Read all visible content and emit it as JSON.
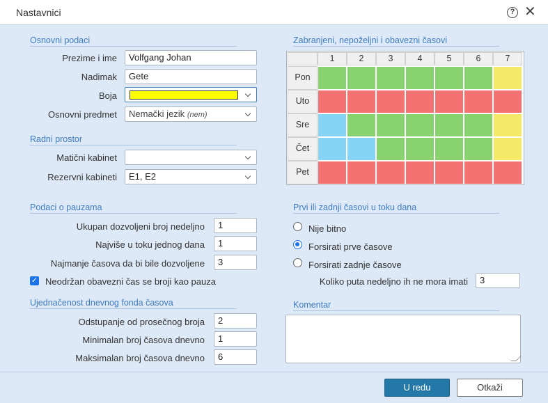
{
  "dialog": {
    "title": "Nastavnici",
    "help_icon": "?",
    "close_icon": "✕"
  },
  "basic": {
    "heading": "Osnovni podaci",
    "name_label": "Prezime i ime",
    "name_value": "Volfgang Johan",
    "nick_label": "Nadimak",
    "nick_value": "Gete",
    "color_label": "Boja",
    "color_value": "#ffff00",
    "subject_label": "Osnovni predmet",
    "subject_value": "Nemački jezik",
    "subject_abbr": "(nem)"
  },
  "workspace": {
    "heading": "Radni prostor",
    "home_label": "Matični kabinet",
    "home_value": "",
    "reserve_label": "Rezervni kabineti",
    "reserve_value": "E1, E2"
  },
  "breaks": {
    "heading": "Podaci o pauzama",
    "weekly_label": "Ukupan dozvoljeni broj nedeljno",
    "weekly_value": "1",
    "daily_label": "Najviše u toku jednog dana",
    "daily_value": "1",
    "min_label": "Najmanje časova da bi bile dozvoljene",
    "min_value": "3",
    "checkbox_label": "Neodržan obavezni čas se broji kao pauza",
    "checkbox_checked": true
  },
  "balance": {
    "heading": "Ujednačenost dnevnog fonda časova",
    "dev_label": "Odstupanje od prosečnog broja",
    "dev_value": "2",
    "min_label": "Minimalan broj časova dnevno",
    "min_value": "1",
    "max_label": "Maksimalan broj časova dnevno",
    "max_value": "6"
  },
  "schedule": {
    "heading": "Zabranjeni, nepoželjni i obavezni časovi",
    "periods": [
      "1",
      "2",
      "3",
      "4",
      "5",
      "6",
      "7"
    ],
    "days": [
      {
        "label": "Pon",
        "cells": [
          "g",
          "g",
          "g",
          "g",
          "g",
          "g",
          "y"
        ]
      },
      {
        "label": "Uto",
        "cells": [
          "r",
          "r",
          "r",
          "r",
          "r",
          "r",
          "r"
        ]
      },
      {
        "label": "Sre",
        "cells": [
          "b",
          "g",
          "g",
          "g",
          "g",
          "g",
          "y"
        ]
      },
      {
        "label": "Čet",
        "cells": [
          "b",
          "b",
          "g",
          "g",
          "g",
          "g",
          "y"
        ]
      },
      {
        "label": "Pet",
        "cells": [
          "r",
          "r",
          "r",
          "r",
          "r",
          "r",
          "r"
        ]
      }
    ],
    "colors": {
      "g": "#88d36f",
      "r": "#f47272",
      "b": "#85d3f5",
      "y": "#f5ea67"
    }
  },
  "first_last": {
    "heading": "Prvi ili zadnji časovi u toku dana",
    "options": [
      "Nije bitno",
      "Forsirati prve časove",
      "Forsirati zadnje časove"
    ],
    "selected": 1,
    "times_label": "Koliko puta nedeljno ih ne mora imati",
    "times_value": "3"
  },
  "comment": {
    "heading": "Komentar",
    "value": ""
  },
  "footer": {
    "ok_label": "U redu",
    "cancel_label": "Otkaži"
  }
}
